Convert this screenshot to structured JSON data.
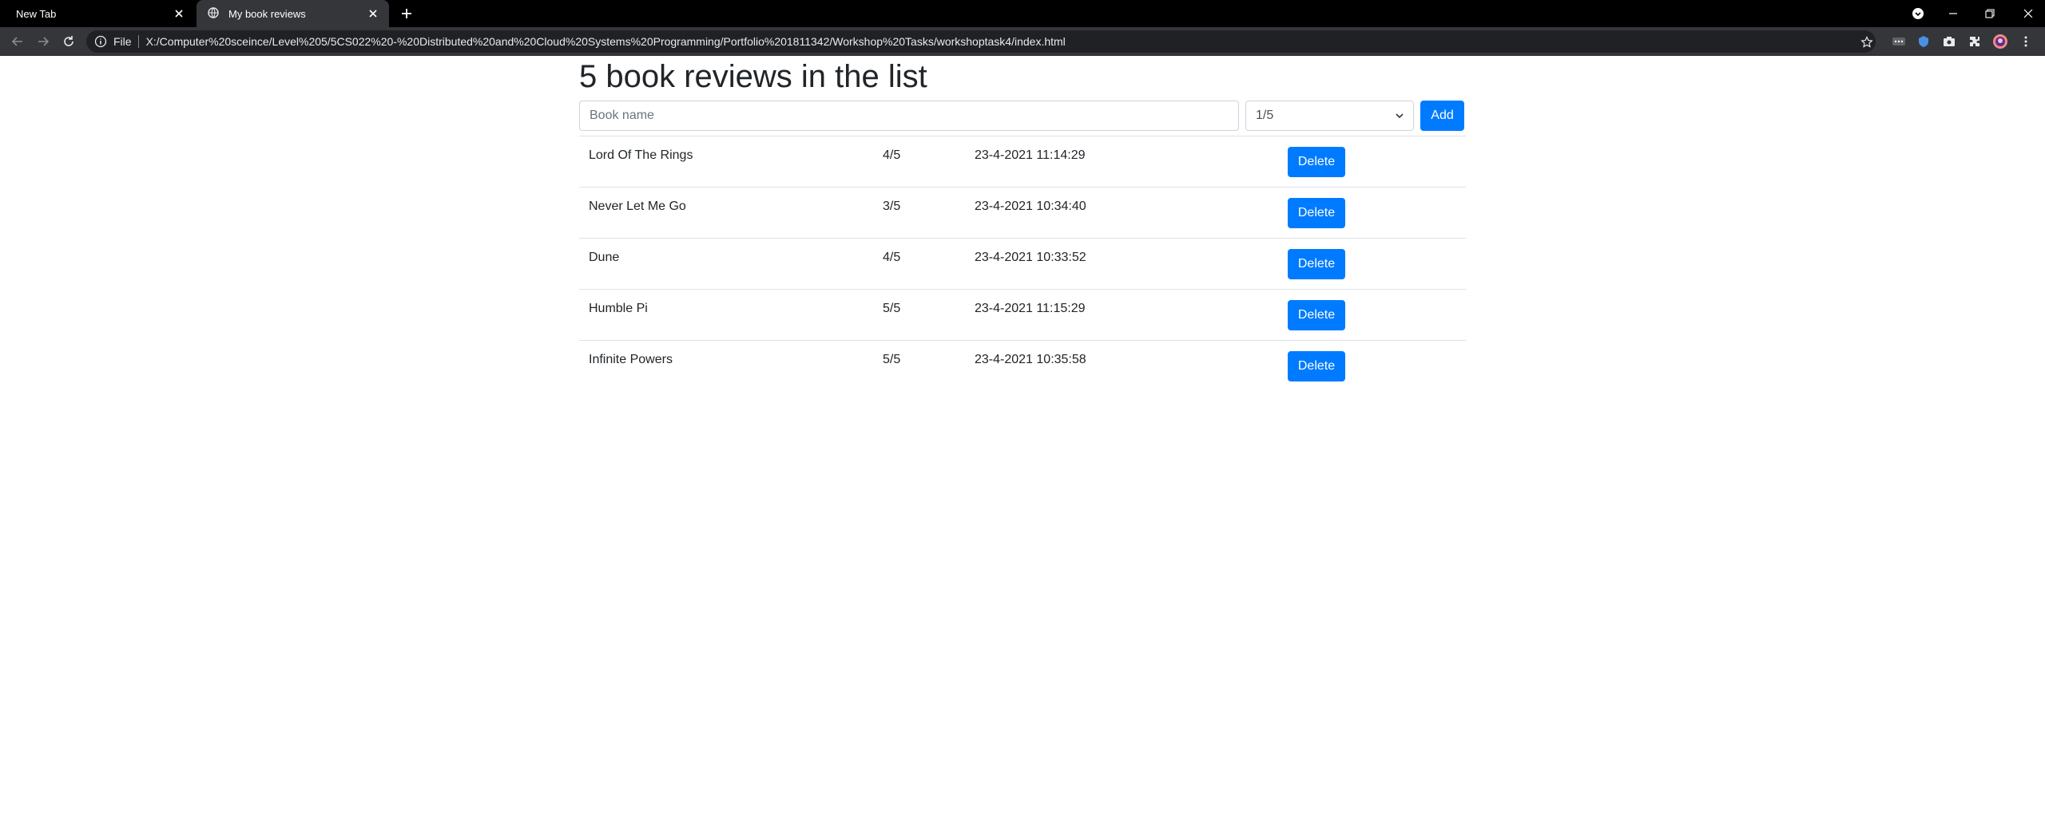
{
  "browser": {
    "tabs": [
      {
        "title": "New Tab",
        "active": false
      },
      {
        "title": "My book reviews",
        "active": true
      }
    ],
    "address": {
      "scheme_label": "File",
      "url": "X:/Computer%20sceince/Level%205/5CS022%20-%20Distributed%20and%20Cloud%20Systems%20Programming/Portfolio%201811342/Workshop%20Tasks/workshoptask4/index.html"
    },
    "icons": [
      "back-icon",
      "forward-icon",
      "reload-icon",
      "info-icon",
      "star-icon",
      "new-tab-icon",
      "tab-close-icon",
      "globe-icon",
      "minimize-icon",
      "restore-icon",
      "close-window-icon",
      "extensions-icon",
      "menu-icon"
    ]
  },
  "page": {
    "heading": "5 book reviews in the list",
    "form": {
      "book_placeholder": "Book name",
      "rating_selected": "1/5",
      "add_label": "Add"
    },
    "reviews": [
      {
        "name": "Lord Of The Rings",
        "rating": "4/5",
        "date": "23-4-2021 11:14:29",
        "action": "Delete"
      },
      {
        "name": "Never Let Me Go",
        "rating": "3/5",
        "date": "23-4-2021 10:34:40",
        "action": "Delete"
      },
      {
        "name": "Dune",
        "rating": "4/5",
        "date": "23-4-2021 10:33:52",
        "action": "Delete"
      },
      {
        "name": "Humble Pi",
        "rating": "5/5",
        "date": "23-4-2021 11:15:29",
        "action": "Delete"
      },
      {
        "name": "Infinite Powers",
        "rating": "5/5",
        "date": "23-4-2021 10:35:58",
        "action": "Delete"
      }
    ]
  },
  "colors": {
    "primary": "#007bff",
    "chrome_dark": "#000000",
    "toolbar": "#35363a",
    "omnibox": "#202124"
  }
}
